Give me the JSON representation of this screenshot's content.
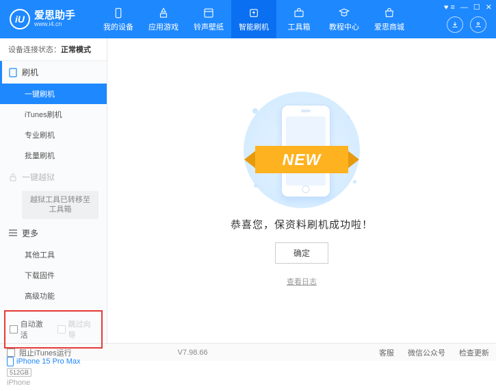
{
  "header": {
    "logo_letter": "iU",
    "title": "爱思助手",
    "url": "www.i4.cn",
    "nav": [
      "我的设备",
      "应用游戏",
      "铃声壁纸",
      "智能刷机",
      "工具箱",
      "教程中心",
      "爱思商城"
    ]
  },
  "sidebar": {
    "status_label": "设备连接状态：",
    "status_mode": "正常模式",
    "section_flash": "刷机",
    "items_flash": [
      "一键刷机",
      "iTunes刷机",
      "专业刷机",
      "批量刷机"
    ],
    "section_jail": "一键越狱",
    "jail_note": "越狱工具已转移至工具箱",
    "section_more": "更多",
    "items_more": [
      "其他工具",
      "下载固件",
      "高级功能"
    ],
    "cb_auto_activate": "自动激活",
    "cb_skip_guide": "跳过向导",
    "device_name": "iPhone 15 Pro Max",
    "device_storage": "512GB",
    "device_brand": "iPhone"
  },
  "main": {
    "ribbon": "NEW",
    "success": "恭喜您，保资料刷机成功啦！",
    "ok": "确定",
    "view_log": "查看日志"
  },
  "footer": {
    "block_itunes": "阻止iTunes运行",
    "version": "V7.98.66",
    "links": [
      "客服",
      "微信公众号",
      "检查更新"
    ]
  }
}
